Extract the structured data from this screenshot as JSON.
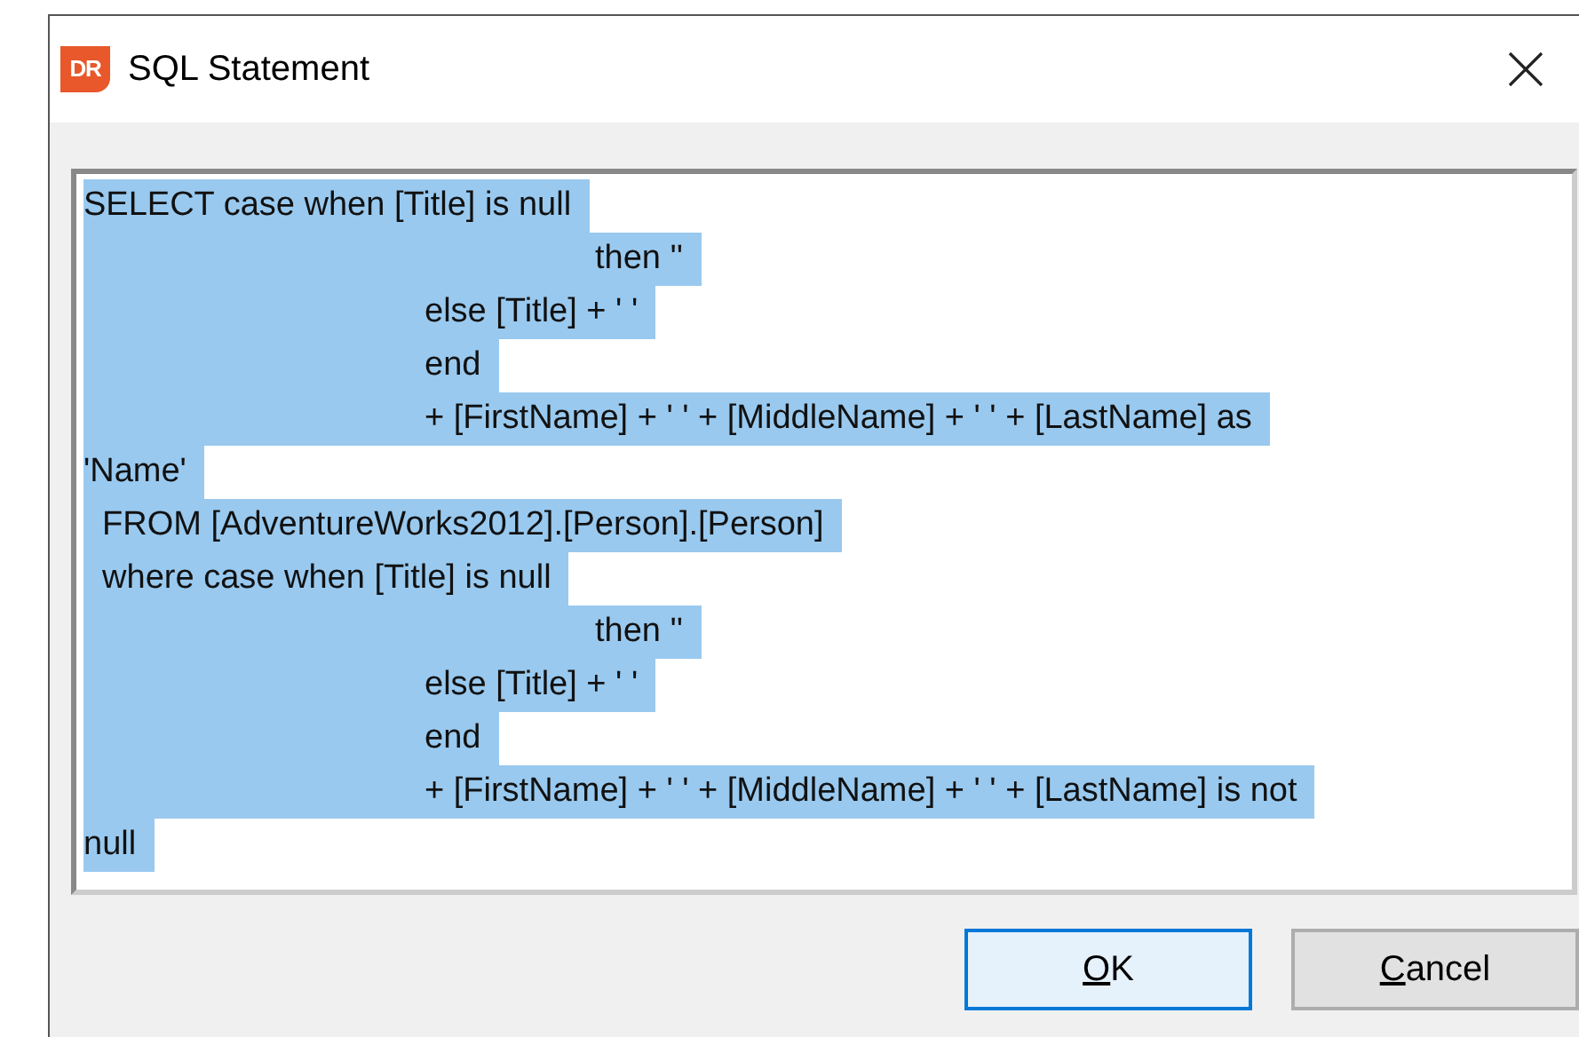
{
  "window": {
    "title": "SQL Statement",
    "app_icon_text": "DR"
  },
  "sql_editor": {
    "selected": true,
    "lines": [
      "SELECT case when [Title] is null",
      "\t\t\t\t\t\tthen ''",
      "\t\t\t\telse [Title] + ' '",
      "\t\t\t\tend",
      "\t\t\t\t+ [FirstName] + ' ' + [MiddleName] + ' ' + [LastName] as",
      "'Name'",
      "  FROM [AdventureWorks2012].[Person].[Person]",
      "  where case when [Title] is null",
      "\t\t\t\t\t\tthen ''",
      "\t\t\t\telse [Title] + ' '",
      "\t\t\t\tend",
      "\t\t\t\t+ [FirstName] + ' ' + [MiddleName] + ' ' + [LastName] is not",
      "null"
    ]
  },
  "buttons": [
    {
      "label": "OK",
      "default": true
    },
    {
      "label": "Cancel",
      "default": false
    }
  ]
}
